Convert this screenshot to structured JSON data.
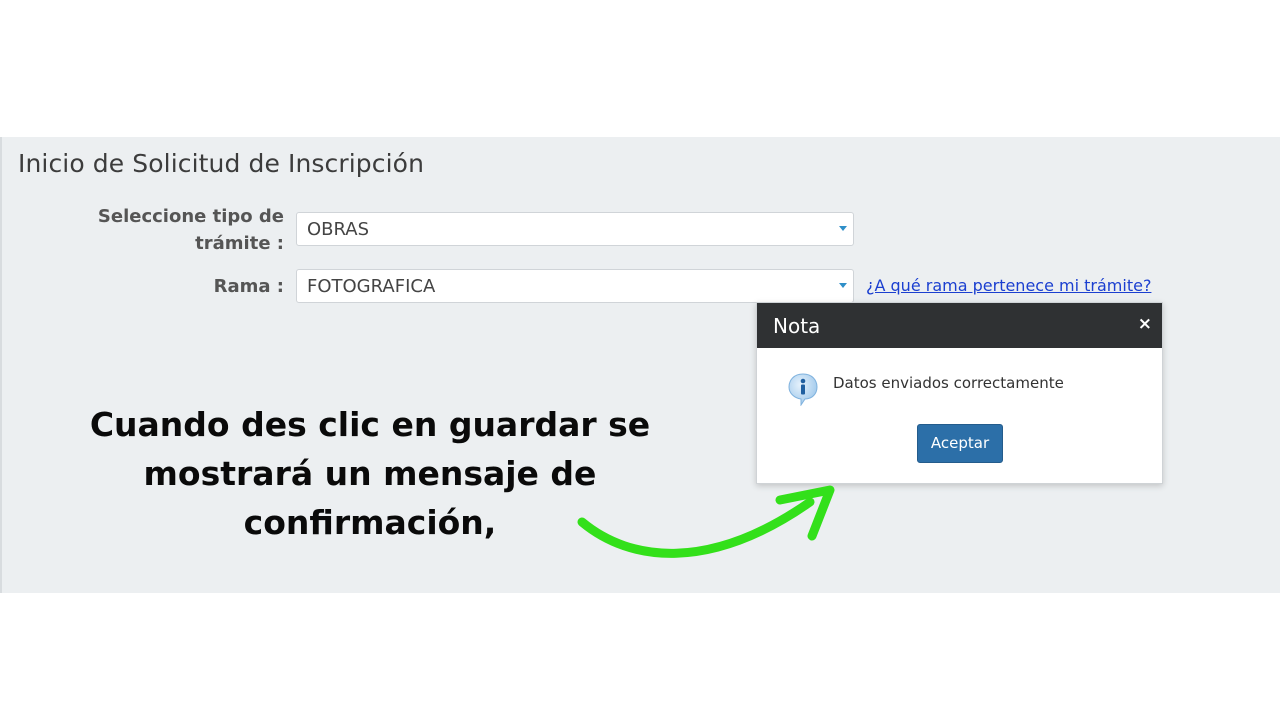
{
  "form": {
    "title": "Inicio de Solicitud de Inscripción",
    "tipo_label": "Seleccione tipo de trámite :",
    "tipo_value": "OBRAS",
    "rama_label": "Rama :",
    "rama_value": "FOTOGRAFICA",
    "help_link": "¿A qué rama pertenece mi trámite?"
  },
  "dialog": {
    "title": "Nota",
    "close_symbol": "×",
    "message": "Datos enviados correctamente",
    "accept_label": "Aceptar",
    "icon": "info-icon"
  },
  "caption": {
    "lines": [
      "Cuando des clic en guardar se",
      "mostrará un mensaje de",
      "confirmación,"
    ]
  },
  "colors": {
    "panel_bg": "#eceff1",
    "dialog_header": "#2f3133",
    "accept_button": "#2c6fa8",
    "link": "#1b3fd0",
    "arrow": "#33e01a"
  }
}
